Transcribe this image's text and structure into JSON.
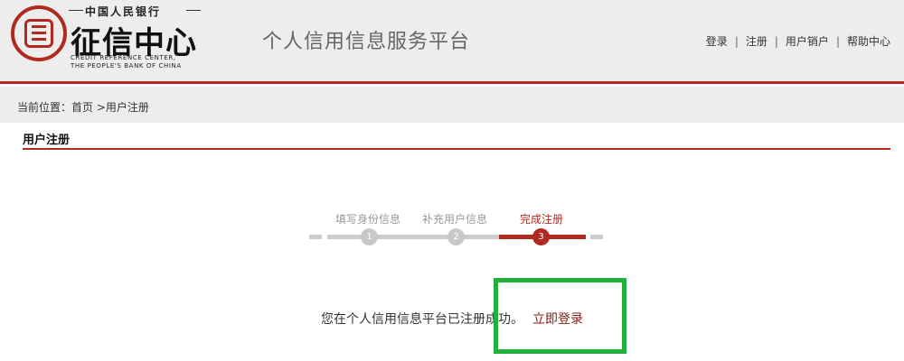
{
  "header": {
    "logo_top": "中国人民银行",
    "logo_main": "征信中心",
    "logo_en_1": "CREDIT REFERENCE CENTER,",
    "logo_en_2": "THE PEOPLE'S BANK OF CHINA",
    "platform_title": "个人信用信息服务平台",
    "nav": [
      "登录",
      "注册",
      "用户销户",
      "帮助中心"
    ],
    "nav_separator": "|"
  },
  "breadcrumb": {
    "prefix": "当前位置：",
    "home": "首页",
    "separator": ">",
    "current": "用户注册"
  },
  "section": {
    "title": "用户注册"
  },
  "steps": [
    {
      "label": "填写身份信息",
      "number": "1",
      "state": "done"
    },
    {
      "label": "补充用户信息",
      "number": "2",
      "state": "done"
    },
    {
      "label": "完成注册",
      "number": "3",
      "state": "active"
    }
  ],
  "result": {
    "message": "您在个人信用信息平台已注册成功。",
    "login_link": "立即登录"
  },
  "colors": {
    "brand_red": "#b02a20",
    "highlight_green": "#22b03c",
    "header_bg": "#ededed"
  }
}
